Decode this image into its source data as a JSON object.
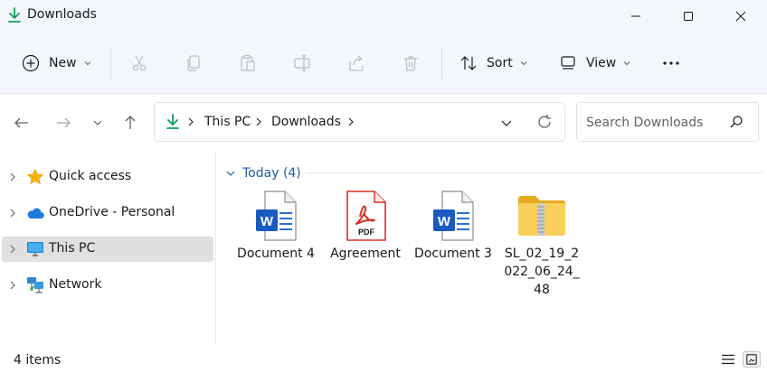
{
  "window": {
    "title": "Downloads",
    "icon": "download-arrow-icon",
    "controls": [
      "minimize-icon",
      "maximize-icon",
      "close-icon"
    ]
  },
  "toolbar": {
    "new_label": "New",
    "sort_label": "Sort",
    "view_label": "View",
    "more": "more-options-icon",
    "icons": [
      "cut-icon",
      "copy-icon",
      "paste-icon",
      "rename-icon",
      "share-icon",
      "delete-icon"
    ]
  },
  "address": {
    "crumbs": [
      "This PC",
      "Downloads"
    ]
  },
  "search": {
    "placeholder": "Search Downloads"
  },
  "nav": {
    "items": [
      {
        "label": "Quick access",
        "icon": "star-icon"
      },
      {
        "label": "OneDrive - Personal",
        "icon": "cloud-icon"
      },
      {
        "label": "This PC",
        "icon": "monitor-icon",
        "selected": true
      },
      {
        "label": "Network",
        "icon": "network-icon"
      }
    ]
  },
  "content": {
    "group_label": "Today (4)",
    "files": [
      {
        "name": "Document 4",
        "type": "word-document-icon"
      },
      {
        "name": "Agreement",
        "type": "pdf-icon",
        "badge": "PDF"
      },
      {
        "name": "Document 3",
        "type": "word-document-icon"
      },
      {
        "name": "SL_02_19_2022_06_24_48",
        "type": "zip-folder-icon"
      }
    ]
  },
  "status": {
    "count": "4 items"
  },
  "colors": {
    "accent": "#1c5fa8",
    "chrome": "#f3f6fb",
    "selected": "#e0e0e0",
    "word_blue": "#185abd",
    "pdf_red": "#d93025",
    "folder_yellow": "#f5c342",
    "download_green": "#0f9d58"
  }
}
